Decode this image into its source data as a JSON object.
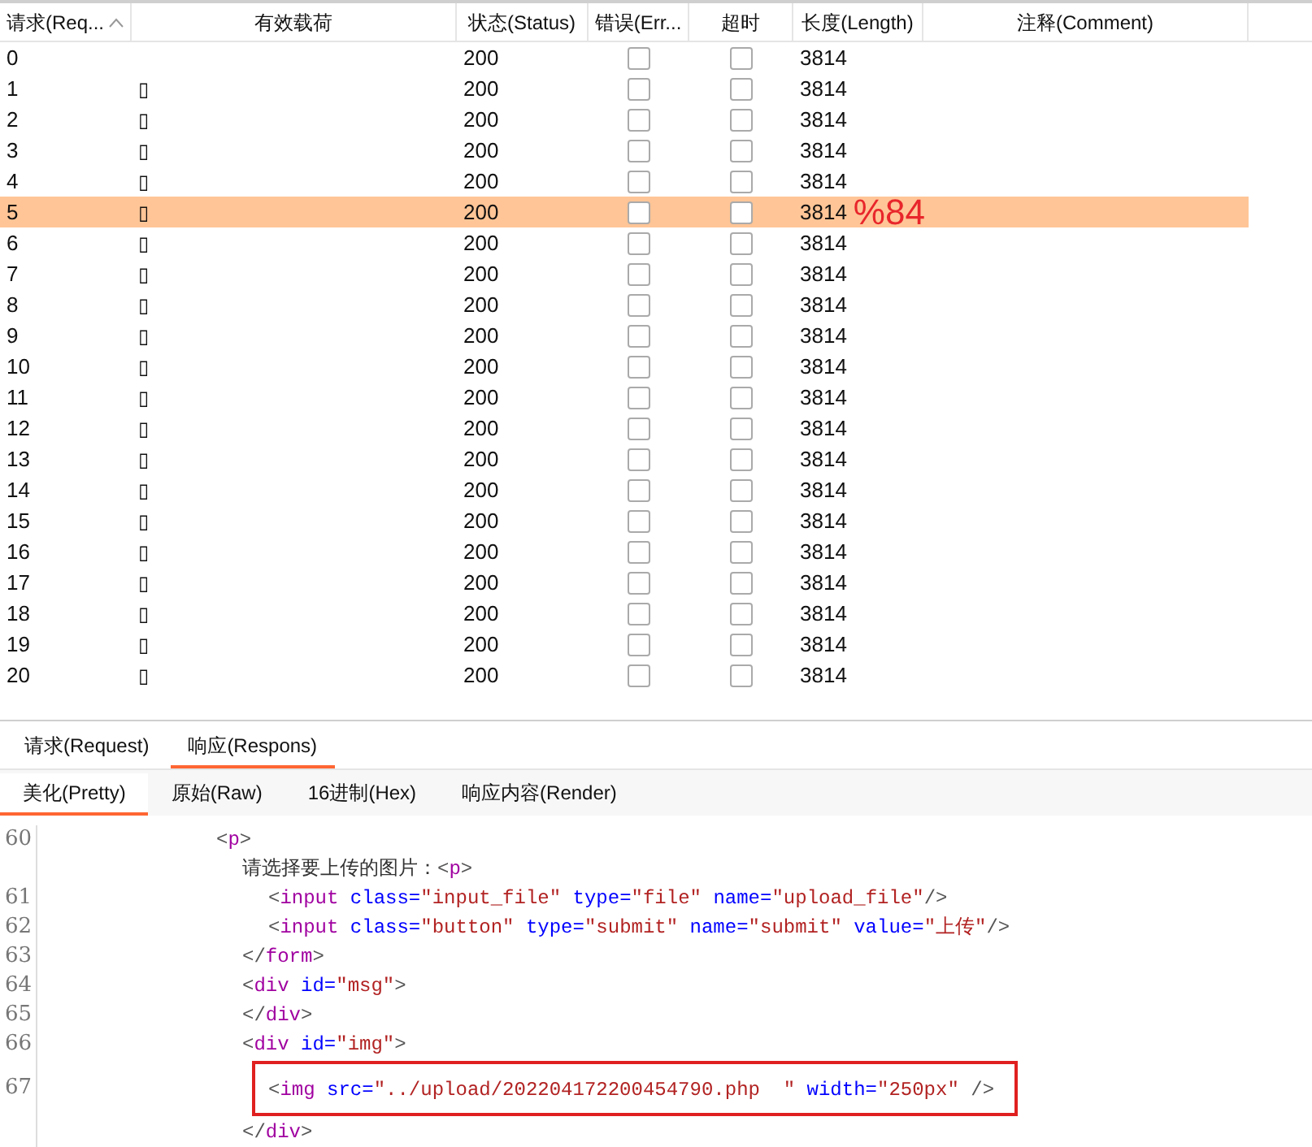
{
  "table": {
    "columns": [
      {
        "label": "请求(Req...",
        "sorted": true
      },
      {
        "label": "有效载荷"
      },
      {
        "label": "状态(Status)"
      },
      {
        "label": "错误(Err..."
      },
      {
        "label": "超时"
      },
      {
        "label": "长度(Length)"
      },
      {
        "label": "注释(Comment)"
      }
    ],
    "rows": [
      {
        "request": "0",
        "status": "200",
        "error": false,
        "timeout": false,
        "length": "3814",
        "selected": false
      },
      {
        "request": "1",
        "payload": "▯",
        "status": "200",
        "error": false,
        "timeout": false,
        "length": "3814",
        "selected": false
      },
      {
        "request": "2",
        "payload": "▯",
        "status": "200",
        "error": false,
        "timeout": false,
        "length": "3814",
        "selected": false
      },
      {
        "request": "3",
        "payload": "▯",
        "status": "200",
        "error": false,
        "timeout": false,
        "length": "3814",
        "selected": false
      },
      {
        "request": "4",
        "payload": "▯",
        "status": "200",
        "error": false,
        "timeout": false,
        "length": "3814",
        "selected": false
      },
      {
        "request": "5",
        "payload": "▯",
        "status": "200",
        "error": false,
        "timeout": false,
        "length": "3814",
        "selected": true,
        "annotation": "%84"
      },
      {
        "request": "6",
        "payload": "▯",
        "status": "200",
        "error": false,
        "timeout": false,
        "length": "3814",
        "selected": false
      },
      {
        "request": "7",
        "payload": "▯",
        "status": "200",
        "error": false,
        "timeout": false,
        "length": "3814",
        "selected": false
      },
      {
        "request": "8",
        "payload": "▯",
        "status": "200",
        "error": false,
        "timeout": false,
        "length": "3814",
        "selected": false
      },
      {
        "request": "9",
        "payload": "▯",
        "status": "200",
        "error": false,
        "timeout": false,
        "length": "3814",
        "selected": false
      },
      {
        "request": "10",
        "payload": "▯",
        "status": "200",
        "error": false,
        "timeout": false,
        "length": "3814",
        "selected": false
      },
      {
        "request": "11",
        "payload": "▯",
        "status": "200",
        "error": false,
        "timeout": false,
        "length": "3814",
        "selected": false
      },
      {
        "request": "12",
        "payload": "▯",
        "status": "200",
        "error": false,
        "timeout": false,
        "length": "3814",
        "selected": false
      },
      {
        "request": "13",
        "payload": "▯",
        "status": "200",
        "error": false,
        "timeout": false,
        "length": "3814",
        "selected": false
      },
      {
        "request": "14",
        "payload": "▯",
        "status": "200",
        "error": false,
        "timeout": false,
        "length": "3814",
        "selected": false
      },
      {
        "request": "15",
        "payload": "▯",
        "status": "200",
        "error": false,
        "timeout": false,
        "length": "3814",
        "selected": false
      },
      {
        "request": "16",
        "payload": "▯",
        "status": "200",
        "error": false,
        "timeout": false,
        "length": "3814",
        "selected": false
      },
      {
        "request": "17",
        "payload": "▯",
        "status": "200",
        "error": false,
        "timeout": false,
        "length": "3814",
        "selected": false
      },
      {
        "request": "18",
        "payload": "▯",
        "status": "200",
        "error": false,
        "timeout": false,
        "length": "3814",
        "selected": false
      },
      {
        "request": "19",
        "payload": "▯",
        "status": "200",
        "error": false,
        "timeout": false,
        "length": "3814",
        "selected": false
      },
      {
        "request": "20",
        "payload": "▯",
        "status": "200",
        "error": false,
        "timeout": false,
        "length": "3814",
        "selected": false
      }
    ]
  },
  "tabs": [
    {
      "label": "请求(Request)",
      "selected": false
    },
    {
      "label": "响应(Respons)",
      "selected": true
    }
  ],
  "subtabs": [
    {
      "label": "美化(Pretty)",
      "selected": true
    },
    {
      "label": "原始(Raw)",
      "selected": false
    },
    {
      "label": "16进制(Hex)",
      "selected": false
    },
    {
      "label": "响应内容(Render)",
      "selected": false
    }
  ],
  "code": [
    {
      "number": "60",
      "tokens": [
        {
          "kind": "punct",
          "text": "<"
        },
        {
          "kind": "tag",
          "text": "p"
        },
        {
          "kind": "punct",
          "text": ">"
        }
      ],
      "children": [
        {
          "tokens": [
            {
              "kind": "text",
              "text": "请选择要上传的图片："
            },
            {
              "kind": "punct",
              "text": "<"
            },
            {
              "kind": "tag",
              "text": "p"
            },
            {
              "kind": "punct",
              "text": ">"
            }
          ],
          "children": [
            {
              "number": "61",
              "tokens": [
                {
                  "kind": "punct",
                  "text": "<"
                },
                {
                  "kind": "tag",
                  "text": "input"
                },
                {
                  "kind": "attr",
                  "text": " class="
                },
                {
                  "kind": "value",
                  "text": "\"input_file\""
                },
                {
                  "kind": "attr",
                  "text": " type="
                },
                {
                  "kind": "value",
                  "text": "\"file\""
                },
                {
                  "kind": "attr",
                  "text": " name="
                },
                {
                  "kind": "value",
                  "text": "\"upload_file\""
                },
                {
                  "kind": "punct",
                  "text": "/>"
                }
              ]
            },
            {
              "number": "62",
              "tokens": [
                {
                  "kind": "punct",
                  "text": "<"
                },
                {
                  "kind": "tag",
                  "text": "input"
                },
                {
                  "kind": "attr",
                  "text": " class="
                },
                {
                  "kind": "value",
                  "text": "\"button\""
                },
                {
                  "kind": "attr",
                  "text": " type="
                },
                {
                  "kind": "value",
                  "text": "\"submit\""
                },
                {
                  "kind": "attr",
                  "text": " name="
                },
                {
                  "kind": "value",
                  "text": "\"submit\""
                },
                {
                  "kind": "attr",
                  "text": " value="
                },
                {
                  "kind": "value",
                  "text": "\"上传\""
                },
                {
                  "kind": "punct",
                  "text": "/>"
                }
              ]
            }
          ]
        },
        {
          "number": "63",
          "tokens": [
            {
              "kind": "punct",
              "text": "</"
            },
            {
              "kind": "tag",
              "text": "form"
            },
            {
              "kind": "punct",
              "text": ">"
            }
          ]
        },
        {
          "number": "64",
          "tokens": [
            {
              "kind": "punct",
              "text": "<"
            },
            {
              "kind": "tag",
              "text": "div"
            },
            {
              "kind": "attr",
              "text": " id="
            },
            {
              "kind": "value",
              "text": "\"msg\""
            },
            {
              "kind": "punct",
              "text": ">"
            }
          ]
        },
        {
          "number": "65",
          "tokens": [
            {
              "kind": "punct",
              "text": "</"
            },
            {
              "kind": "tag",
              "text": "div"
            },
            {
              "kind": "punct",
              "text": ">"
            }
          ]
        },
        {
          "number": "66",
          "tokens": [
            {
              "kind": "punct",
              "text": "<"
            },
            {
              "kind": "tag",
              "text": "div"
            },
            {
              "kind": "attr",
              "text": " id="
            },
            {
              "kind": "value",
              "text": "\"img\""
            },
            {
              "kind": "punct",
              "text": ">"
            }
          ],
          "children": [
            {
              "number": "67",
              "highlighted": true,
              "tokens": [
                {
                  "kind": "punct",
                  "text": "<"
                },
                {
                  "kind": "tag",
                  "text": "img"
                },
                {
                  "kind": "attr",
                  "text": " src="
                },
                {
                  "kind": "value",
                  "text": "\"../upload/202204172200454790.php  \""
                },
                {
                  "kind": "attr",
                  "text": " width="
                },
                {
                  "kind": "value",
                  "text": "\"250px\""
                },
                {
                  "kind": "punct",
                  "text": " />"
                }
              ]
            }
          ]
        },
        {
          "tokens": [
            {
              "kind": "punct",
              "text": "</"
            },
            {
              "kind": "tag",
              "text": "div"
            },
            {
              "kind": "punct",
              "text": ">"
            }
          ]
        }
      ]
    }
  ]
}
